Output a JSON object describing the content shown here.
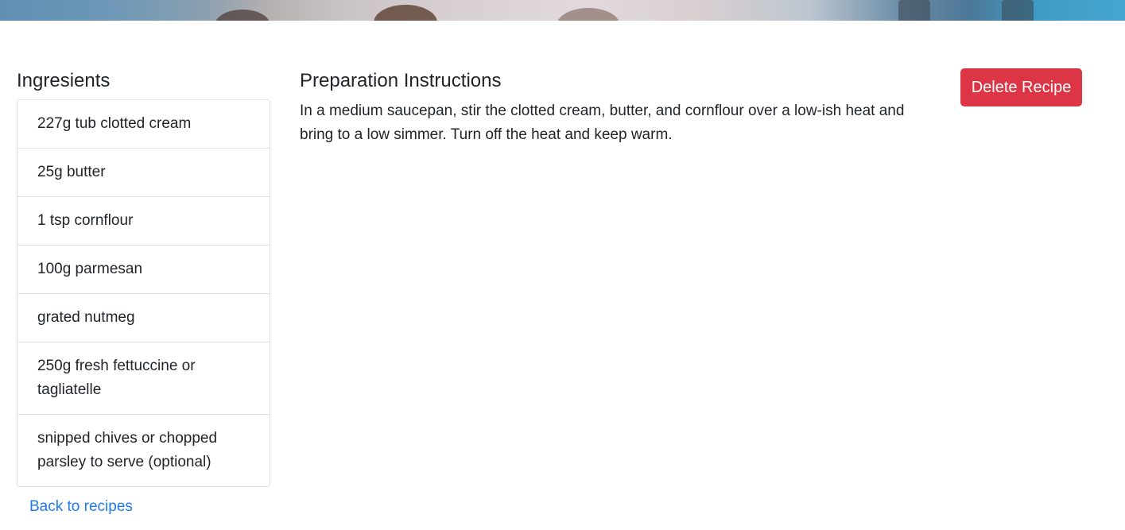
{
  "ingredients": {
    "title": "Ingresients",
    "items": [
      "227g tub clotted cream",
      "25g butter",
      "1 tsp cornflour",
      "100g parmesan",
      "grated nutmeg",
      "250g fresh fettuccine or tagliatelle",
      "snipped chives or chopped parsley to serve (optional)"
    ],
    "back_link": "Back to recipes"
  },
  "preparation": {
    "title": "Preparation Instructions",
    "text": "In a medium saucepan, stir the clotted cream, butter, and cornflour over a low-ish heat and bring to a low simmer. Turn off the heat and keep warm."
  },
  "actions": {
    "delete_label": "Delete Recipe"
  },
  "colors": {
    "danger": "#dc3545",
    "link": "#1f7bf0",
    "border": "#dee2e6",
    "text": "#212529"
  }
}
